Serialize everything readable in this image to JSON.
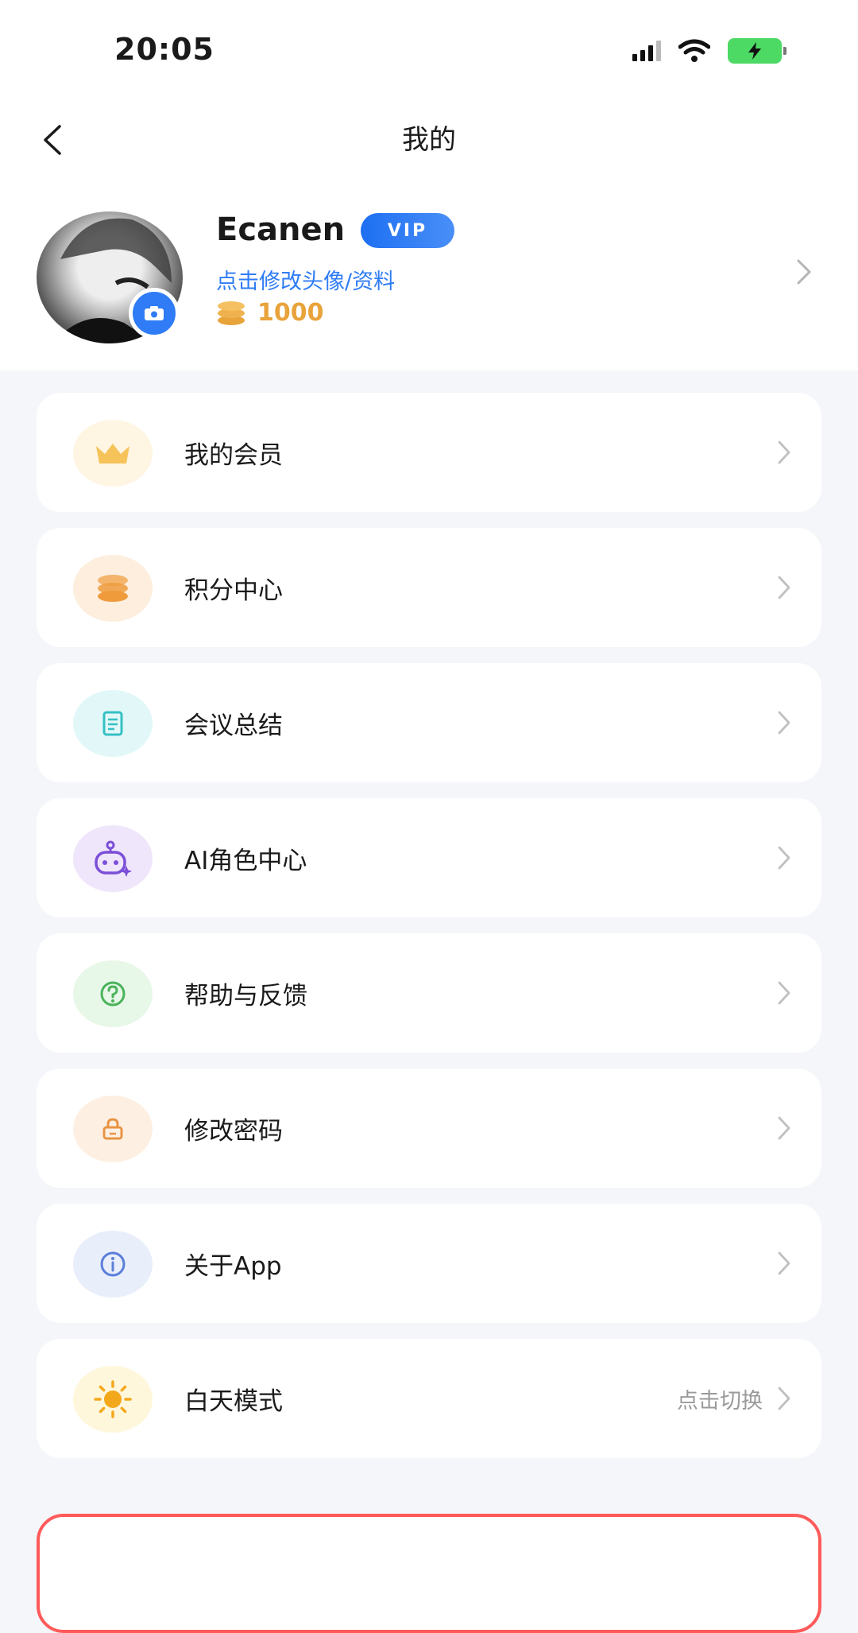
{
  "status_bar": {
    "time": "20:05"
  },
  "nav": {
    "title": "我的"
  },
  "profile": {
    "username": "Ecanen",
    "vip_badge": "VIP",
    "edit_link": "点击修改头像/资料",
    "coins": "1000"
  },
  "menu": {
    "items": [
      {
        "label": "我的会员",
        "icon": "crown-icon",
        "bg": "#fff5e3",
        "color": "#f5c35a"
      },
      {
        "label": "积分中心",
        "icon": "coins-icon",
        "bg": "#fdeede",
        "color": "#ef9b3c"
      },
      {
        "label": "会议总结",
        "icon": "document-icon",
        "bg": "#e2f8f8",
        "color": "#35c0c4"
      },
      {
        "label": "AI角色中心",
        "icon": "robot-icon",
        "bg": "#efe6fb",
        "color": "#7b4fd8"
      },
      {
        "label": "帮助与反馈",
        "icon": "help-icon",
        "bg": "#e7f7e8",
        "color": "#4ab35a"
      },
      {
        "label": "修改密码",
        "icon": "lock-icon",
        "bg": "#fdf0e3",
        "color": "#e89444"
      },
      {
        "label": "关于App",
        "icon": "info-icon",
        "bg": "#e9eefb",
        "color": "#5b7fd8"
      },
      {
        "label": "白天模式",
        "icon": "sun-icon",
        "bg": "#fff7dc",
        "color": "#f3a81b",
        "right_text": "点击切换"
      }
    ]
  },
  "colors": {
    "accent": "#2f7cf6",
    "coin": "#e9a33b",
    "logout_border": "#ff5a5a"
  }
}
